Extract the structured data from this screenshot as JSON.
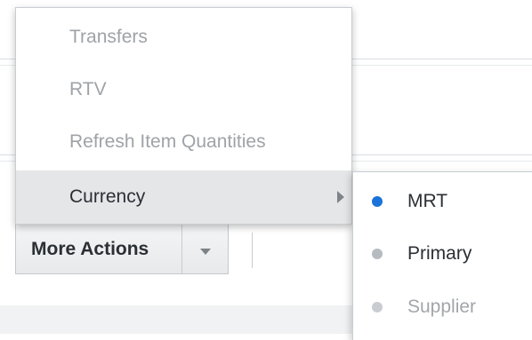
{
  "menu": {
    "items": [
      {
        "label": "Transfers",
        "state": "disabled"
      },
      {
        "label": "RTV",
        "state": "disabled"
      },
      {
        "label": "Refresh Item Quantities",
        "state": "disabled"
      },
      {
        "label": "Currency",
        "state": "highlighted",
        "has_submenu": true
      }
    ]
  },
  "submenu": {
    "items": [
      {
        "label": "MRT",
        "selected": true
      },
      {
        "label": "Primary",
        "selected": false
      },
      {
        "label": "Supplier",
        "selected": false,
        "state": "disabled"
      }
    ]
  },
  "more_actions": {
    "label": "More Actions",
    "arrow_icon": "chevron-down-icon"
  },
  "colors": {
    "selected_dot": "#1a73d9",
    "highlight_bg": "#e4e6e8",
    "disabled_text": "#9fa3a7"
  }
}
